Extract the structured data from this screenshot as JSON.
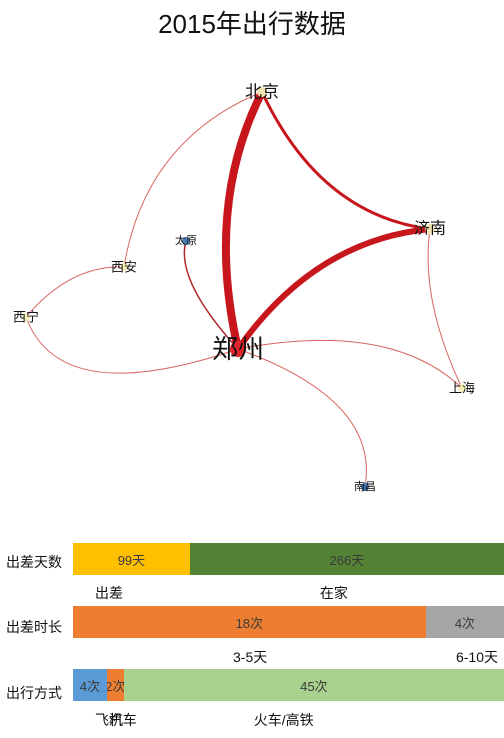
{
  "title": "2015年出行数据",
  "chart_data": [
    {
      "type": "network",
      "nodes": [
        {
          "name": "北京",
          "color": "#f3e3b0",
          "size": 5
        },
        {
          "name": "济南",
          "color": "#f3e3b0",
          "size": 5
        },
        {
          "name": "太原",
          "color": "#4a7fb5",
          "size": 4
        },
        {
          "name": "西安",
          "color": "#f6efb8",
          "size": 4
        },
        {
          "name": "西宁",
          "color": "#f6efb8",
          "size": 4
        },
        {
          "name": "郑州",
          "color": "#e4262c",
          "size": 8
        },
        {
          "name": "上海",
          "color": "#f6efb8",
          "size": 4
        },
        {
          "name": "南昌",
          "color": "#3d6fa6",
          "size": 4
        }
      ],
      "edges": [
        {
          "source": "郑州",
          "target": "北京",
          "weight": 8
        },
        {
          "source": "郑州",
          "target": "济南",
          "weight": 6
        },
        {
          "source": "北京",
          "target": "济南",
          "weight": 3
        },
        {
          "source": "郑州",
          "target": "太原",
          "weight": 1.5
        },
        {
          "source": "北京",
          "target": "西安",
          "weight": 1
        },
        {
          "source": "西安",
          "target": "西宁",
          "weight": 1
        },
        {
          "source": "西宁",
          "target": "郑州",
          "weight": 1
        },
        {
          "source": "济南",
          "target": "上海",
          "weight": 1
        },
        {
          "source": "郑州",
          "target": "上海",
          "weight": 1
        },
        {
          "source": "郑州",
          "target": "南昌",
          "weight": 1
        }
      ]
    },
    {
      "type": "bar",
      "stacked": true,
      "label": "出差天数",
      "series": [
        {
          "name": "出差",
          "value": 99,
          "display": "99天",
          "color": "#ffc000"
        },
        {
          "name": "在家",
          "value": 266,
          "display": "266天",
          "color": "#548235"
        }
      ]
    },
    {
      "type": "bar",
      "stacked": true,
      "label": "出差时长",
      "series": [
        {
          "name": "3-5天",
          "value": 18,
          "display": "18次",
          "color": "#ed7d31"
        },
        {
          "name": "6-10天",
          "value": 4,
          "display": "4次",
          "color": "#a5a5a5"
        }
      ]
    },
    {
      "type": "bar",
      "stacked": true,
      "label": "出行方式",
      "series": [
        {
          "name": "飞机",
          "value": 4,
          "display": "4次",
          "color": "#5b9bd5"
        },
        {
          "name": "汽车",
          "value": 2,
          "display": "2次",
          "color": "#ed7d31"
        },
        {
          "name": "火车/高铁",
          "value": 45,
          "display": "45次",
          "color": "#a9d18e"
        }
      ]
    }
  ]
}
